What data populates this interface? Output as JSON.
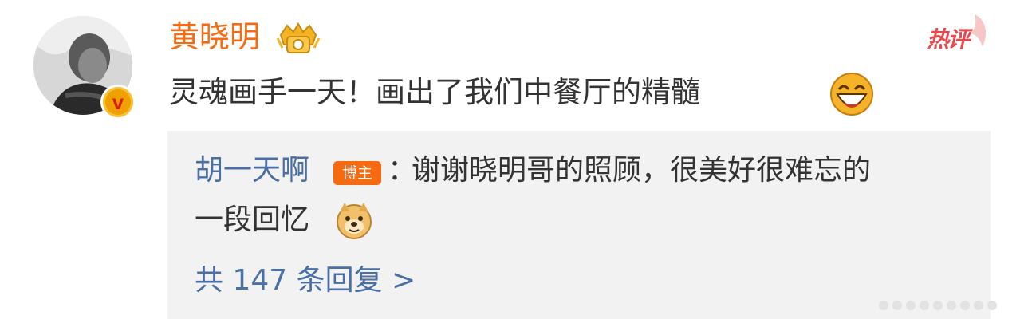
{
  "post": {
    "username": "黄晓明",
    "verified_badge": "v",
    "hot_label": "热评",
    "text": "灵魂画手一天！画出了我们中餐厅的精髓"
  },
  "reply": {
    "user": "胡一天啊",
    "tag": "博主",
    "colon": "：",
    "text_line1": "谢谢晓明哥的照顾，很美好很难忘的",
    "text_line2": "一段回忆",
    "more": "共 147 条回复 >"
  },
  "icons": [
    "avatar",
    "verified-icon",
    "crown-icon",
    "hot-icon",
    "laugh-emoji-icon",
    "doge-emoji-icon"
  ],
  "colors": {
    "username": "#f76a0f",
    "link": "#4a6fa5",
    "reply_bg": "#f2f2f2",
    "hot": "#e8484d"
  }
}
